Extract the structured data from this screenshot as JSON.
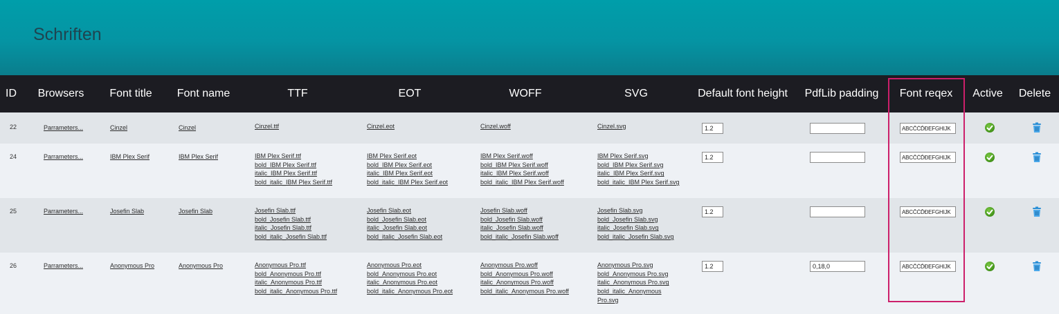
{
  "page": {
    "title": "Schriften"
  },
  "columns": {
    "id": "ID",
    "browsers": "Browsers",
    "font_title": "Font title",
    "font_name": "Font name",
    "ttf": "TTF",
    "eot": "EOT",
    "woff": "WOFF",
    "svg": "SVG",
    "default_font_height": "Default font height",
    "pdflib_padding": "PdfLib padding",
    "font_regex": "Font reqex",
    "active": "Active",
    "delete": "Delete"
  },
  "icons": {
    "active": "check-circle-icon",
    "delete": "trash-icon"
  },
  "colors": {
    "header": "#009eaa",
    "table_header": "#1c1c22",
    "highlight": "#cc1f6a",
    "active": "#4a9a1f",
    "delete": "#2a8fd6"
  },
  "rows": [
    {
      "id": "22",
      "browsers": "Parrameters...",
      "font_title": "Cinzel",
      "font_name": "Cinzel",
      "ttf": [
        "Cinzel.ttf"
      ],
      "eot": [
        "Cinzel.eot"
      ],
      "woff": [
        "Cinzel.woff"
      ],
      "svg": [
        "Cinzel.svg"
      ],
      "default_font_height": "1.2",
      "pdflib_padding": "",
      "font_regex": "ABCČĆĎĐEFGHIJK"
    },
    {
      "id": "24",
      "browsers": "Parrameters...",
      "font_title": "IBM Plex Serif",
      "font_name": "IBM Plex Serif",
      "ttf": [
        "IBM Plex Serif.ttf",
        "bold_IBM Plex Serif.ttf",
        "italic_IBM Plex Serif.ttf",
        "bold_italic_IBM Plex Serif.ttf"
      ],
      "eot": [
        "IBM Plex Serif.eot",
        "bold_IBM Plex Serif.eot",
        "italic_IBM Plex Serif.eot",
        "bold_italic_IBM Plex Serif.eot"
      ],
      "woff": [
        "IBM Plex Serif.woff",
        "bold_IBM Plex Serif.woff",
        "italic_IBM Plex Serif.woff",
        "bold_italic_IBM Plex Serif.woff"
      ],
      "svg": [
        "IBM Plex Serif.svg",
        "bold_IBM Plex Serif.svg",
        "italic_IBM Plex Serif.svg",
        "bold_italic_IBM Plex Serif.svg"
      ],
      "default_font_height": "1.2",
      "pdflib_padding": "",
      "font_regex": "ABCČĆĎĐEFGHIJK"
    },
    {
      "id": "25",
      "browsers": "Parrameters...",
      "font_title": "Josefin Slab",
      "font_name": "Josefin Slab",
      "ttf": [
        "Josefin Slab.ttf",
        "bold_Josefin Slab.ttf",
        "italic_Josefin Slab.ttf",
        "bold_italic_Josefin Slab.ttf"
      ],
      "eot": [
        "Josefin Slab.eot",
        "bold_Josefin Slab.eot",
        "italic_Josefin Slab.eot",
        "bold_italic_Josefin Slab.eot"
      ],
      "woff": [
        "Josefin Slab.woff",
        "bold_Josefin Slab.woff",
        "italic_Josefin Slab.woff",
        "bold_italic_Josefin Slab.woff"
      ],
      "svg": [
        "Josefin Slab.svg",
        "bold_Josefin Slab.svg",
        "italic_Josefin Slab.svg",
        "bold_italic_Josefin Slab.svg"
      ],
      "default_font_height": "1.2",
      "pdflib_padding": "",
      "font_regex": "ABCČĆĎĐEFGHIJK"
    },
    {
      "id": "26",
      "browsers": "Parrameters...",
      "font_title": "Anonymous Pro",
      "font_name": "Anonymous Pro",
      "ttf": [
        "Anonymous Pro.ttf",
        "bold_Anonymous Pro.ttf",
        "italic_Anonymous Pro.ttf",
        "bold_italic_Anonymous Pro.ttf"
      ],
      "eot": [
        "Anonymous Pro.eot",
        "bold_Anonymous Pro.eot",
        "italic_Anonymous Pro.eot",
        "bold_italic_Anonymous Pro.eot"
      ],
      "woff": [
        "Anonymous Pro.woff",
        "bold_Anonymous Pro.woff",
        "italic_Anonymous Pro.woff",
        "bold_italic_Anonymous Pro.woff"
      ],
      "svg": [
        "Anonymous Pro.svg",
        "bold_Anonymous Pro.svg",
        "italic_Anonymous Pro.svg",
        "bold_italic_Anonymous Pro.svg"
      ],
      "default_font_height": "1.2",
      "pdflib_padding": "0,18,0",
      "font_regex": "ABCČĆĎĐEFGHIJK"
    }
  ]
}
